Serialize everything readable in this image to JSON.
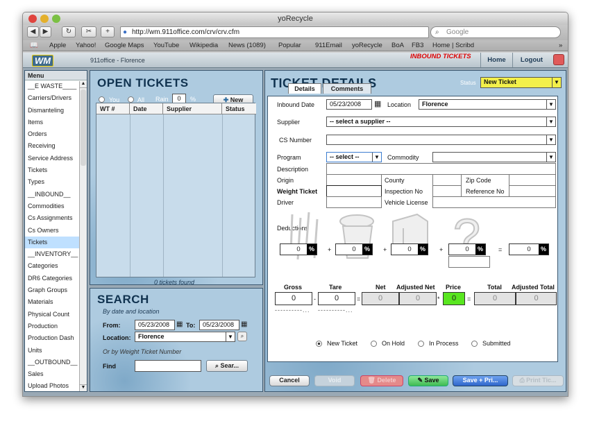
{
  "browser": {
    "title": "yoRecycle",
    "url": "http://wm.911office.com/crv/crv.cfm",
    "search_placeholder": "Google",
    "bookmarks": [
      "Apple",
      "Yahoo!",
      "Google Maps",
      "YouTube",
      "Wikipedia",
      "News (1089)",
      "Popular",
      "911Email",
      "yoRecycle",
      "BoA",
      "FB3",
      "Home | Scribd"
    ]
  },
  "header": {
    "logo": "WM",
    "org": "911office - Florence",
    "mode": "INBOUND TICKETS",
    "home": "Home",
    "logout": "Logout"
  },
  "menu": {
    "title": "Menu",
    "items": [
      "__E WASTE____",
      "Carriers/Drivers",
      "Dismanteling",
      "Items",
      "Orders",
      "Receiving",
      "Service Address",
      "Tickets",
      "Types",
      "__INBOUND__",
      "Commodities",
      "Cs Assignments",
      "Cs Owners",
      "Tickets",
      "__INVENTORY__",
      "Categories",
      "DR6 Categories",
      "Graph Groups",
      "Materials",
      "Physical Count",
      "Production",
      "Production Dash",
      "Units",
      "__OUTBOUND__",
      "Sales",
      "Upload Photos"
    ]
  },
  "open_tickets": {
    "title": "OPEN TICKETS",
    "you": "You",
    "all": "All",
    "rain": "Rain",
    "rain_value": "0",
    "rain_unit": "%",
    "new_label": "New",
    "columns": [
      "WT #",
      "Date",
      "Supplier",
      "Status"
    ],
    "footer": "0 tickets found"
  },
  "search": {
    "title": "SEARCH",
    "subtitle": "By date and location",
    "from_label": "From:",
    "from_value": "05/23/2008",
    "to_label": "To:",
    "to_value": "05/23/2008",
    "location_label": "Location:",
    "location_value": "Florence",
    "or_text": "Or by Weight Ticket Number",
    "find_label": "Find",
    "find_value": "",
    "search_button": "Sear..."
  },
  "ticket": {
    "title": "TICKET DETAILS",
    "status_label": "Status",
    "status_value": "New Ticket",
    "tabs": [
      "Details",
      "Comments"
    ],
    "inbound_date_label": "Inbound Date",
    "inbound_date": "05/23/2008",
    "location_label": "Location",
    "location": "Florence",
    "supplier_label": "Supplier",
    "supplier": "-- select a supplier --",
    "cs_label": "CS Number",
    "program_label": "Program",
    "program": "-- select --",
    "commodity_label": "Commodity",
    "description_label": "Description",
    "origin_label": "Origin",
    "county_label": "County",
    "zip_label": "Zip Code",
    "weight_label": "Weight Ticket",
    "inspection_label": "Inspection No",
    "reference_label": "Reference No",
    "driver_label": "Driver",
    "vehicle_label": "Vehicle License",
    "deductions_label": "Deductions",
    "ded_values": [
      "0",
      "0",
      "0",
      "0"
    ],
    "ded_total": "0",
    "gross_label": "Gross",
    "gross": "0",
    "tare_label": "Tare",
    "tare": "0",
    "net_label": "Net",
    "net": "0",
    "adj_net_label": "Adjusted Net",
    "adj_net": "0",
    "price_label": "Price",
    "price": "0",
    "total_label": "Total",
    "total": "0",
    "adj_total_label": "Adjusted Total",
    "adj_total": "0",
    "radios": [
      "New Ticket",
      "On Hold",
      "In Process",
      "Submitted"
    ],
    "buttons": [
      "Cancel",
      "Void",
      "Delete",
      "Save",
      "Save + Pri...",
      "Print Tic..."
    ]
  },
  "colors": {
    "accent_red": "#dd0000",
    "status_yellow": "#f3f04a",
    "price_green": "#59e620",
    "save_green": "#5fd36a",
    "save_print_blue": "#3f7bdc"
  }
}
